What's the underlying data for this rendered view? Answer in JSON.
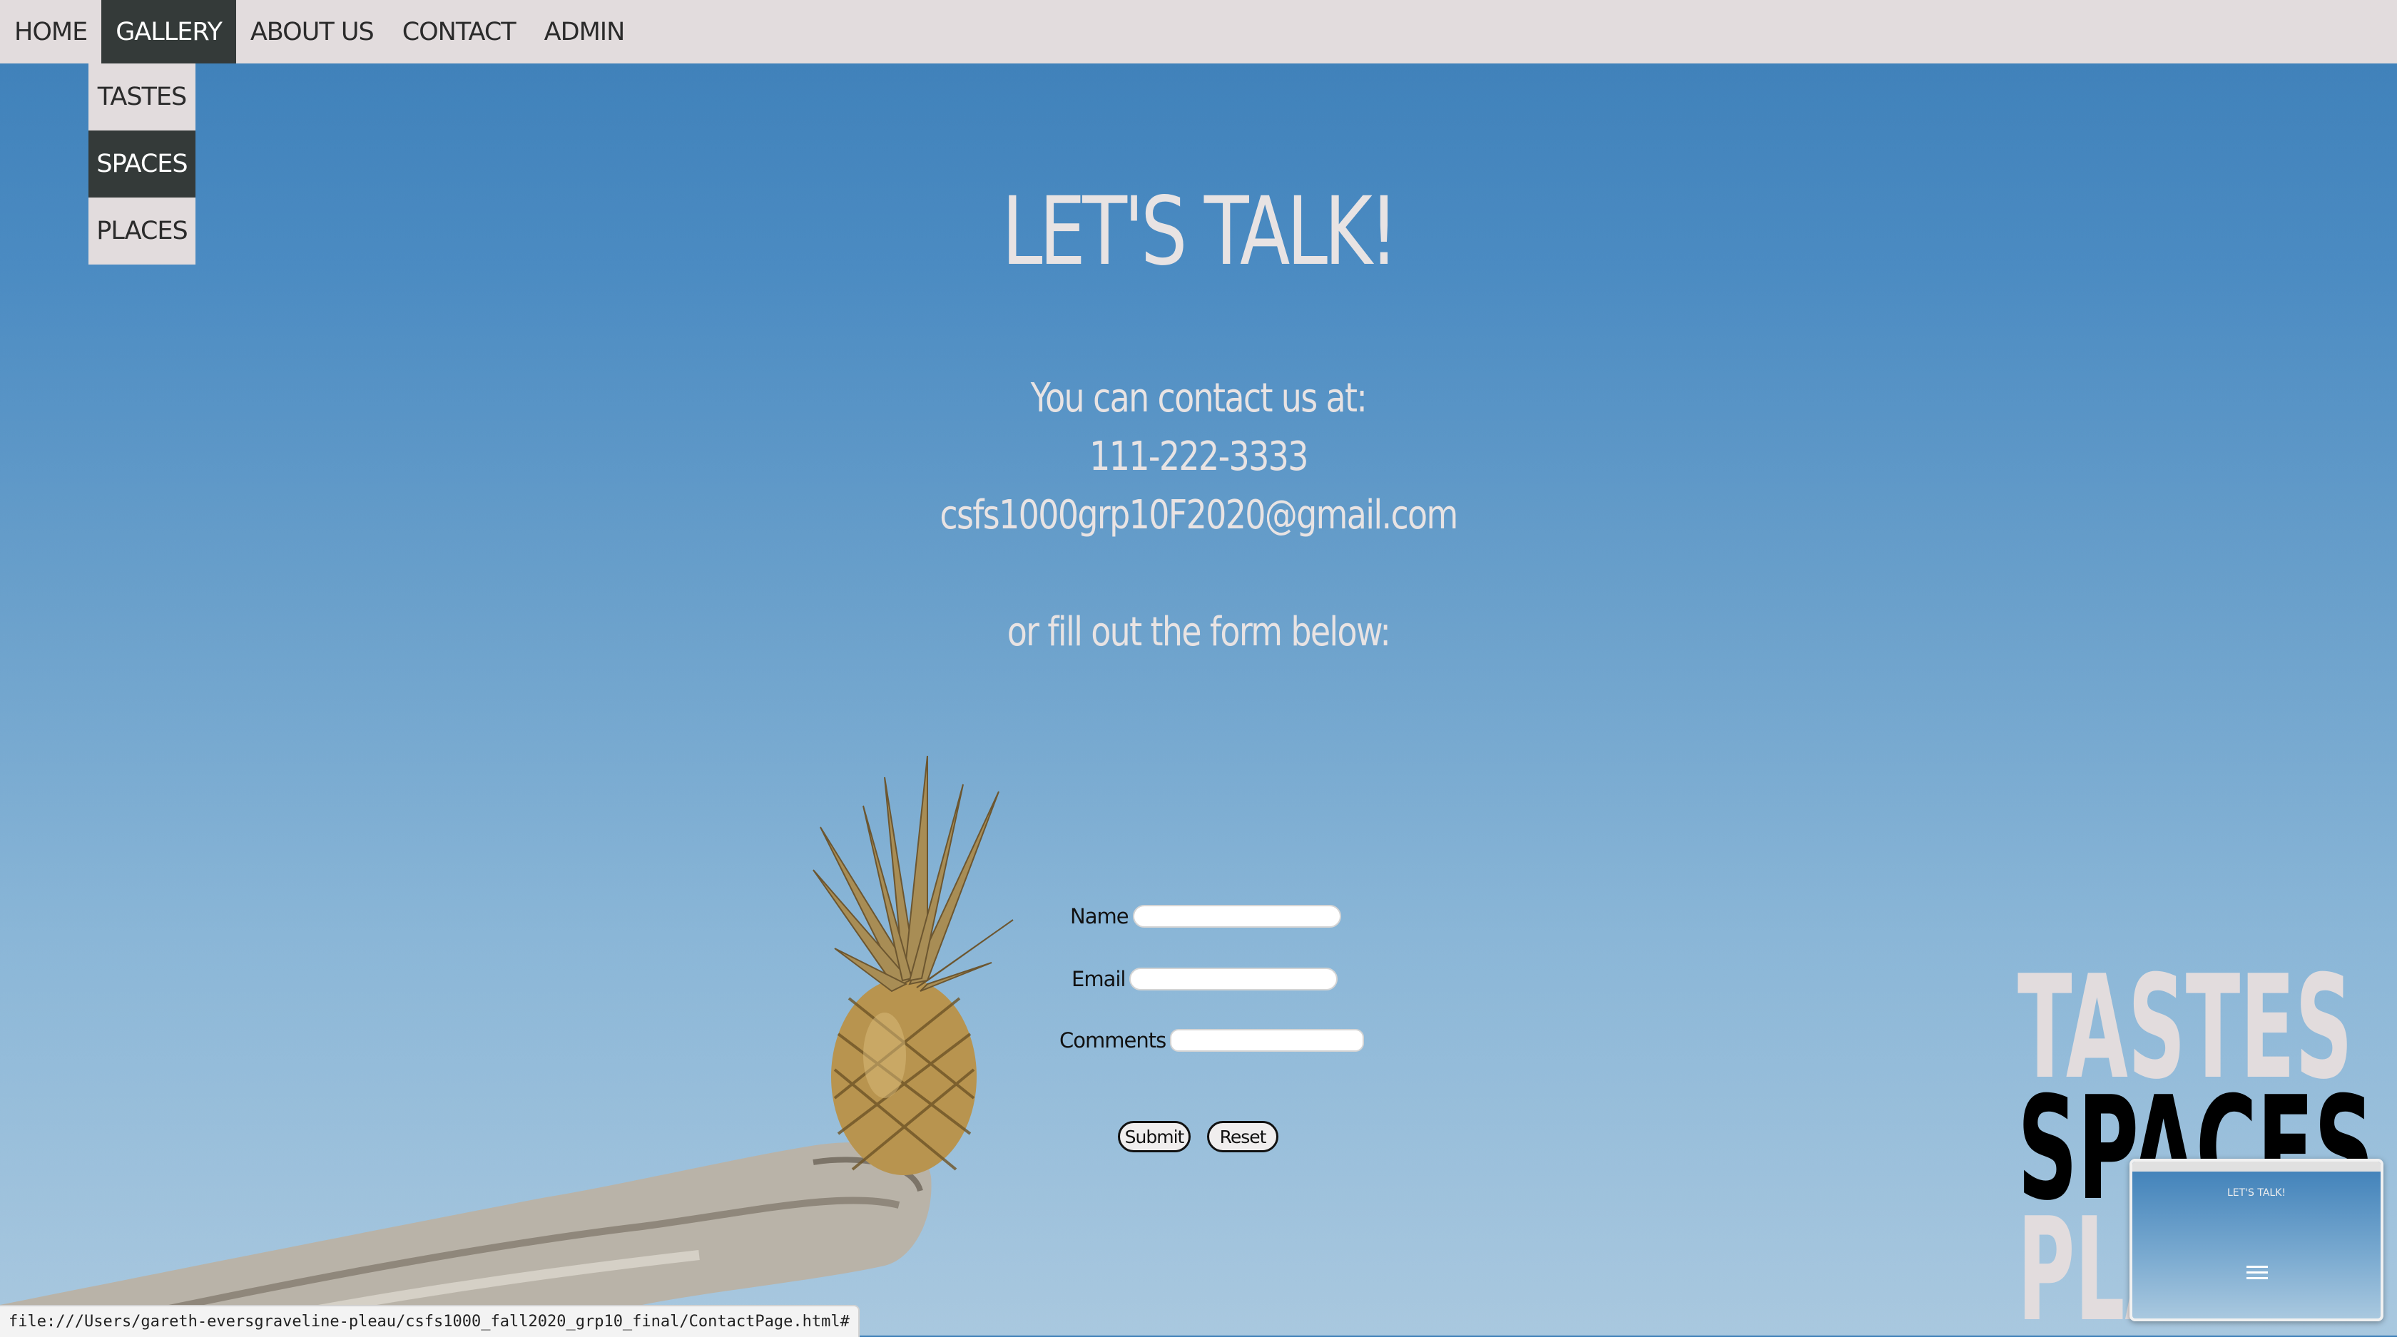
{
  "nav": {
    "items": [
      "HOME",
      "GALLERY",
      "ABOUT US",
      "CONTACT",
      "ADMIN"
    ],
    "active": "GALLERY",
    "dropdown": [
      "TASTES",
      "SPACES",
      "PLACES"
    ],
    "dropdown_active": "SPACES"
  },
  "main": {
    "heading": "LET'S TALK!",
    "contact_intro": "You can contact us at:",
    "phone": "111-222-3333",
    "email": "csfs1000grp10F2020@gmail.com",
    "form_intro": "or fill out the form below:"
  },
  "form": {
    "name_label": "Name",
    "email_label": "Email",
    "comments_label": "Comments",
    "name_value": "",
    "email_value": "",
    "comments_value": "",
    "submit_label": "Submit",
    "reset_label": "Reset"
  },
  "logo": {
    "line1": "TASTES",
    "line2": "SPACES",
    "line3": "PLACES"
  },
  "status_bar": {
    "url": "file:///Users/gareth-eversgraveline-pleau/csfs1000_fall2020_grp10_final/ContactPage.html#"
  },
  "thumbnail": {
    "heading": "LET'S TALK!"
  },
  "colors": {
    "nav_bg": "#e2dcdd",
    "nav_active": "#343a39",
    "text_light": "#e8e3e3",
    "sky_top": "#3d7fb8",
    "sky_bottom": "#a9c8df"
  }
}
